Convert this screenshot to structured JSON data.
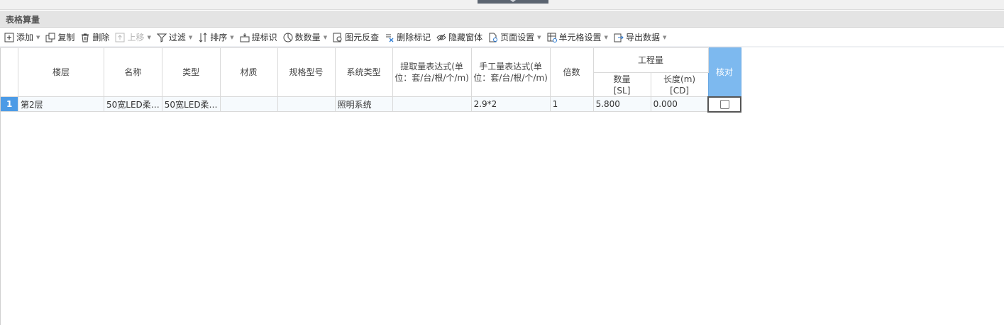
{
  "panel": {
    "title": "表格算量"
  },
  "toolbar": {
    "add": "添加",
    "copy": "复制",
    "delete": "删除",
    "move_up": "上移",
    "filter": "过滤",
    "sort": "排序",
    "extract_mark": "提标识",
    "count": "数数量",
    "reverse_check": "图元反查",
    "delete_mark": "删除标记",
    "hide_window": "隐藏窗体",
    "page_setup": "页面设置",
    "cell_setup": "单元格设置",
    "export": "导出数据"
  },
  "table": {
    "headers": {
      "floor": "楼层",
      "name": "名称",
      "type": "类型",
      "material": "材质",
      "spec": "规格型号",
      "system": "系统类型",
      "extract_expr": "提取量表达式(单位：套/台/根/个/m)",
      "manual_expr": "手工量表达式(单位：套/台/根/个/m)",
      "multiple": "倍数",
      "quantity_group": "工程量",
      "qty": "数量",
      "qty_code": "[SL]",
      "length": "长度(m)",
      "length_code": "[CD]",
      "verify": "核对"
    },
    "rows": [
      {
        "num": "1",
        "floor": "第2层",
        "name": "50宽LED柔…",
        "type": "50宽LED柔…",
        "material": "",
        "spec": "",
        "system": "照明系统",
        "extract_expr": "",
        "manual_expr": "2.9*2",
        "multiple": "1",
        "qty": "5.800",
        "length": "0.000",
        "verified": false
      }
    ]
  }
}
